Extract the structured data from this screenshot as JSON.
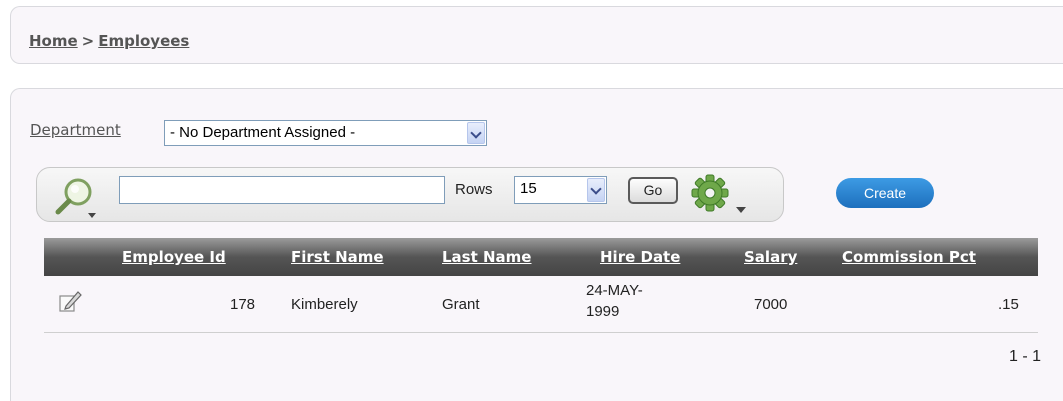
{
  "breadcrumb": {
    "home": "Home",
    "separator": ">",
    "current": "Employees"
  },
  "filters": {
    "department_label": "Department",
    "department_value": "- No Department Assigned -"
  },
  "search": {
    "value": "",
    "rows_label": "Rows",
    "rows_value": "15",
    "go_label": "Go"
  },
  "actions": {
    "create_label": "Create"
  },
  "table": {
    "columns": [
      "Employee Id",
      "First Name",
      "Last Name",
      "Hire Date",
      "Salary",
      "Commission Pct"
    ],
    "rows": [
      {
        "employee_id": "178",
        "first_name": "Kimberely",
        "last_name": "Grant",
        "hire_date_1": "24-MAY-",
        "hire_date_2": "1999",
        "salary": "7000",
        "commission_pct": ".15"
      }
    ]
  },
  "pagination": {
    "range": "1 - 1"
  },
  "icons": {
    "search": "magnifier-icon",
    "actions_menu": "gear-icon",
    "edit": "edit-pencil-icon"
  },
  "colors": {
    "create_button": "#1d6fbd",
    "header_bg": "#555555",
    "panel_bg": "#f9f6fa"
  }
}
